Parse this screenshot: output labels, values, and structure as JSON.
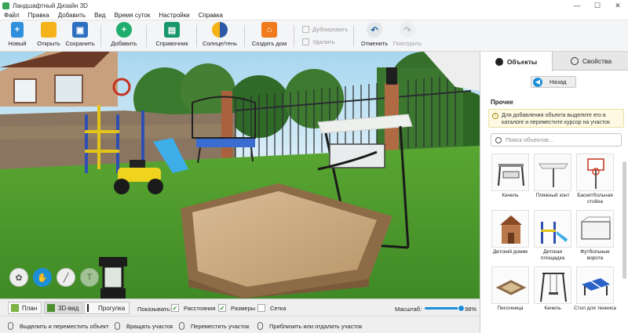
{
  "window": {
    "title": "Ландшафтный Дизайн 3D",
    "controls": [
      "—",
      "☐",
      "✕"
    ]
  },
  "menu": [
    "Файл",
    "Правка",
    "Добавить",
    "Вид",
    "Время суток",
    "Настройки",
    "Справка"
  ],
  "toolbar": {
    "new": "Новый",
    "open": "Открыть",
    "save": "Сохранить",
    "add": "Добавить",
    "guide": "Справочник",
    "sun": "Солнце/тень",
    "create_house": "Создать дом",
    "duplicate": "Дублировать",
    "delete": "Удалить",
    "undo": "Отменить",
    "redo": "Повторить"
  },
  "panel": {
    "tab_objects": "Объекты",
    "tab_properties": "Свойства",
    "back": "Назад",
    "section": "Прочее",
    "hint": "Для добавления объекта выделите его в каталоге и переместите курсор на участок",
    "search_placeholder": "Поиск объектов...",
    "items": [
      {
        "label": "Качель",
        "icon": "swing-bench-icon"
      },
      {
        "label": "Пляжный зонт",
        "icon": "beach-umbrella-icon"
      },
      {
        "label": "Баскетбольная стойка",
        "icon": "basketball-hoop-icon"
      },
      {
        "label": "Детский домик",
        "icon": "playhouse-icon"
      },
      {
        "label": "Детская площадка",
        "icon": "playground-icon"
      },
      {
        "label": "Футбольные ворота",
        "icon": "soccer-goal-icon"
      },
      {
        "label": "Песочница",
        "icon": "sandbox-icon"
      },
      {
        "label": "Качель",
        "icon": "swing-icon"
      },
      {
        "label": "Стол для тенниса",
        "icon": "tennis-table-icon"
      }
    ]
  },
  "viewbar": {
    "plan": "План",
    "view3d": "3D-вид",
    "walk": "Прогулка",
    "show_label": "Показывать:",
    "distances": "Расстояния",
    "sizes": "Размеры",
    "grid": "Сетка",
    "zoom_label": "Масштаб:",
    "zoom_value": "98%",
    "zoom_fraction": 0.98
  },
  "status": {
    "select_move": "Выделить и переместить объект",
    "rotate": "Вращать участок",
    "move": "Переместить участок",
    "zoom": "Приблизить или отдалить участок"
  },
  "colors": {
    "accent": "#1c8fd8",
    "grass": "#4f9a2e",
    "sky": "#c4e4f4",
    "sand": "#c8a57c"
  }
}
